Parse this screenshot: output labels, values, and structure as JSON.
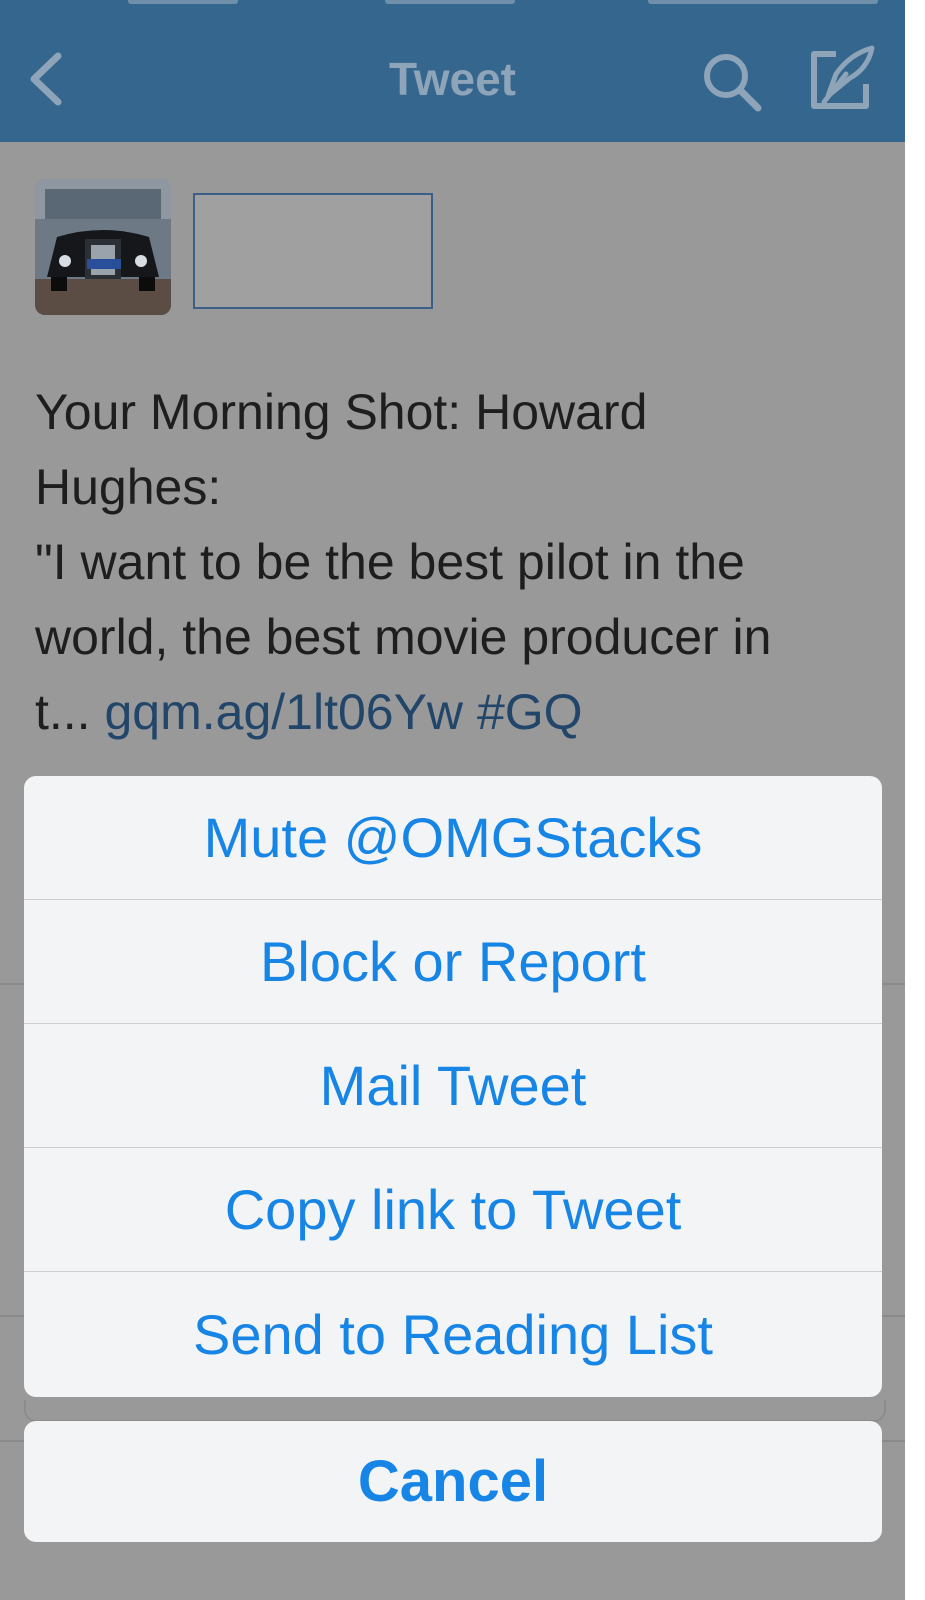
{
  "nav": {
    "title": "Tweet",
    "back_icon": "chevron-left-icon",
    "search_icon": "search-icon",
    "compose_icon": "compose-icon"
  },
  "tweet": {
    "text_line1": "Your Morning Shot: Howard",
    "text_line2": "Hughes:",
    "text_line3": "\"I want to be the best pilot in the",
    "text_line4": "world, the best movie producer in",
    "text_line5_prefix": "t...",
    "link": "gqm.ag/1lt06Yw",
    "hashtag": "#GQ"
  },
  "action_sheet": {
    "items": [
      {
        "label": "Mute @OMGStacks"
      },
      {
        "label": "Block or Report"
      },
      {
        "label": "Mail Tweet"
      },
      {
        "label": "Copy link to Tweet"
      },
      {
        "label": "Send to Reading List"
      }
    ],
    "cancel_label": "Cancel"
  },
  "colors": {
    "navbar": "#35668e",
    "accent": "#1685e6",
    "dim_overlay": "#999999"
  }
}
